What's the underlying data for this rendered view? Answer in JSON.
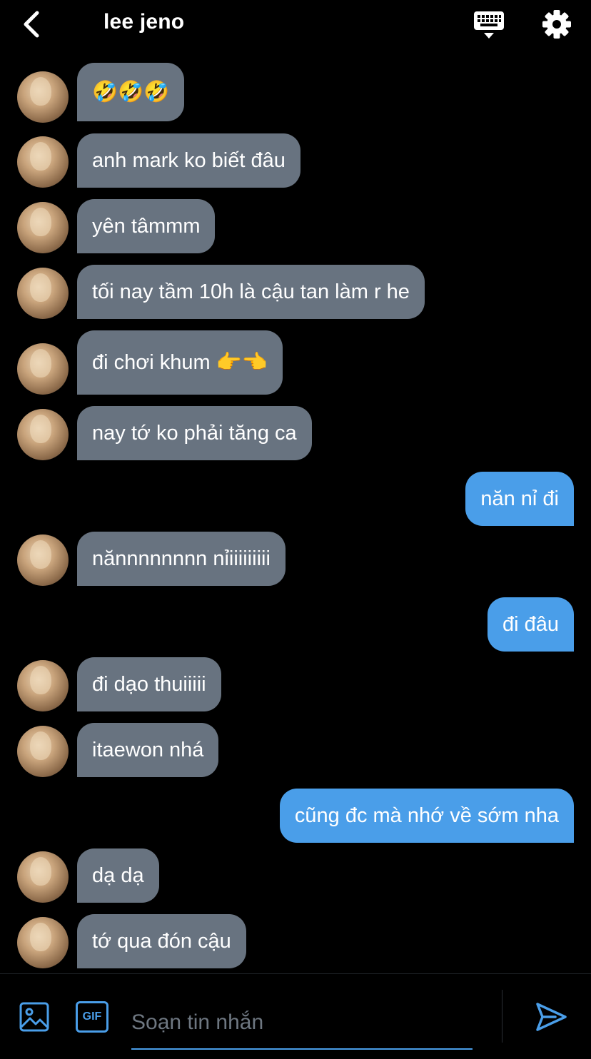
{
  "header": {
    "title": "lee jeno",
    "back_icon": "chevron-left-icon",
    "keyboard_icon": "keyboard-icon",
    "settings_icon": "gear-icon"
  },
  "messages": [
    {
      "from": "them",
      "text": "🤣🤣🤣"
    },
    {
      "from": "them",
      "text": "anh mark ko biết đâu"
    },
    {
      "from": "them",
      "text": "yên tâmmm"
    },
    {
      "from": "them",
      "text": "tối nay tầm 10h là cậu tan làm r he"
    },
    {
      "from": "them",
      "text": "đi chơi khum 👉👈"
    },
    {
      "from": "them",
      "text": "nay tớ ko phải tăng ca"
    },
    {
      "from": "me",
      "text": "năn nỉ đi"
    },
    {
      "from": "them",
      "text": "nănnnnnnnn nỉiiiiiiiii"
    },
    {
      "from": "me",
      "text": "đi đâu"
    },
    {
      "from": "them",
      "text": "đi dạo thuiiiii"
    },
    {
      "from": "them",
      "text": "itaewon nhá"
    },
    {
      "from": "me",
      "text": "cũng đc mà nhớ về sớm nha"
    },
    {
      "from": "them",
      "text": "dạ dạ"
    },
    {
      "from": "them",
      "text": "tớ qua đón cậu"
    }
  ],
  "composer": {
    "placeholder": "Soạn tin nhắn",
    "gif_label": "GIF",
    "image_icon": "image-icon",
    "send_icon": "send-icon"
  },
  "colors": {
    "background": "#000000",
    "incoming_bubble": "#687380",
    "outgoing_bubble": "#4a9ee9",
    "accent": "#4a9ee9"
  }
}
